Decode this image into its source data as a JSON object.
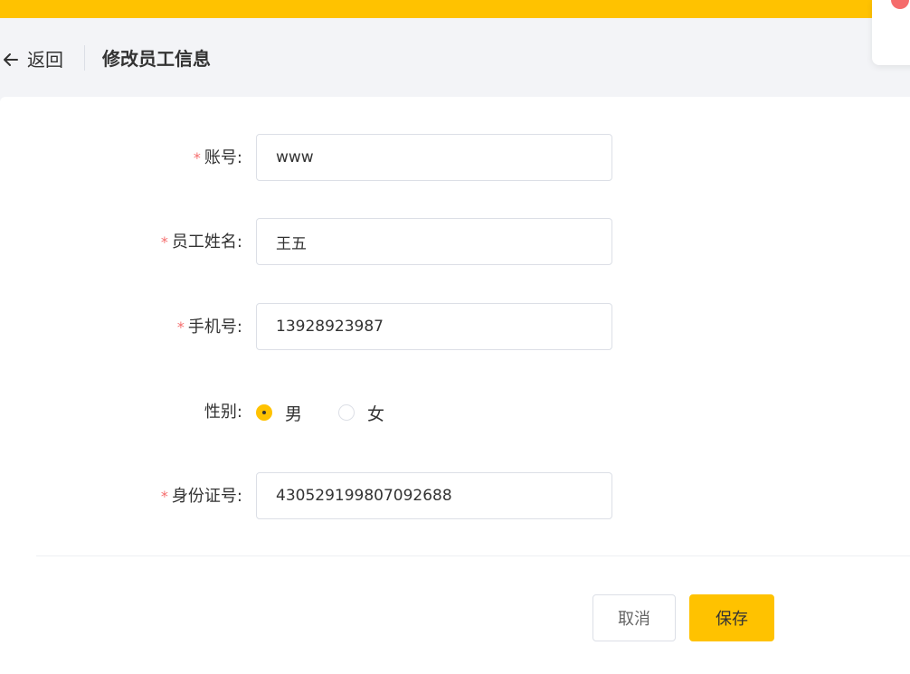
{
  "header": {
    "back_label": "返回",
    "title": "修改员工信息"
  },
  "form": {
    "account": {
      "label": "账号:",
      "required": "*",
      "value": "www"
    },
    "name": {
      "label": "员工姓名:",
      "required": "*",
      "value": "王五"
    },
    "phone": {
      "label": "手机号:",
      "required": "*",
      "value": "13928923987"
    },
    "gender": {
      "label": "性别:",
      "options": [
        "男",
        "女"
      ],
      "selected": "男"
    },
    "id_number": {
      "label": "身份证号:",
      "required": "*",
      "value": "430529199807092688"
    }
  },
  "actions": {
    "cancel_label": "取消",
    "save_label": "保存"
  },
  "colors": {
    "accent": "#ffc200",
    "required": "#f56c6c",
    "background": "#f3f4f7"
  },
  "icons": {
    "back": "arrow-left-icon",
    "notification": "notification-dot-icon"
  }
}
